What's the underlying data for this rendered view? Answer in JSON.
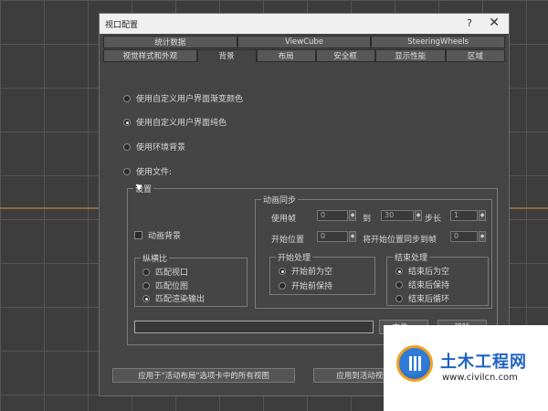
{
  "dialog": {
    "title": "视口配置",
    "help": "?",
    "close": "✕"
  },
  "tabs_row1": [
    {
      "label": "统计数据"
    },
    {
      "label": "ViewCube"
    },
    {
      "label": "SteeringWheels"
    }
  ],
  "tabs_row2": [
    {
      "label": "视觉样式和外观"
    },
    {
      "label": "背景"
    },
    {
      "label": "布局"
    },
    {
      "label": "安全框"
    },
    {
      "label": "显示性能"
    },
    {
      "label": "区域"
    }
  ],
  "background_options": [
    {
      "label": "使用自定义用户界面渐变颜色",
      "selected": false
    },
    {
      "label": "使用自定义用户界面纯色",
      "selected": true
    },
    {
      "label": "使用环境背景",
      "selected": false
    },
    {
      "label": "使用文件:",
      "selected": false
    }
  ],
  "settings": {
    "group_label": "设置",
    "animate_bg_label": "动画背景",
    "aspect": {
      "label": "纵横比",
      "options": [
        {
          "label": "匹配视口",
          "selected": false
        },
        {
          "label": "匹配位图",
          "selected": false
        },
        {
          "label": "匹配渲染输出",
          "selected": true
        }
      ]
    },
    "anim_sync": {
      "label": "动画同步",
      "use_frame_label": "使用帧",
      "use_frame_value": "0",
      "to_label": "到",
      "to_value": "30",
      "step_label": "步长",
      "step_value": "1",
      "start_pos_label": "开始位置",
      "start_pos_value": "0",
      "sync_label": "将开始位置同步到帧",
      "sync_value": "0"
    },
    "start_processing": {
      "label": "开始处理",
      "options": [
        {
          "label": "开始前为空",
          "selected": true
        },
        {
          "label": "开始前保持",
          "selected": false
        }
      ]
    },
    "end_processing": {
      "label": "结束处理",
      "options": [
        {
          "label": "结束后为空",
          "selected": true
        },
        {
          "label": "结束后保持",
          "selected": false
        },
        {
          "label": "结束后循环",
          "selected": false
        }
      ]
    },
    "file_button": "文件...",
    "remove_button": "移除"
  },
  "footer": {
    "apply_all": "应用于\"活动布局\"选项卡中的所有视图",
    "apply_active": "应用到活动视图"
  },
  "watermark": {
    "title": "土木工程网",
    "url": "www.civilcn.com"
  }
}
